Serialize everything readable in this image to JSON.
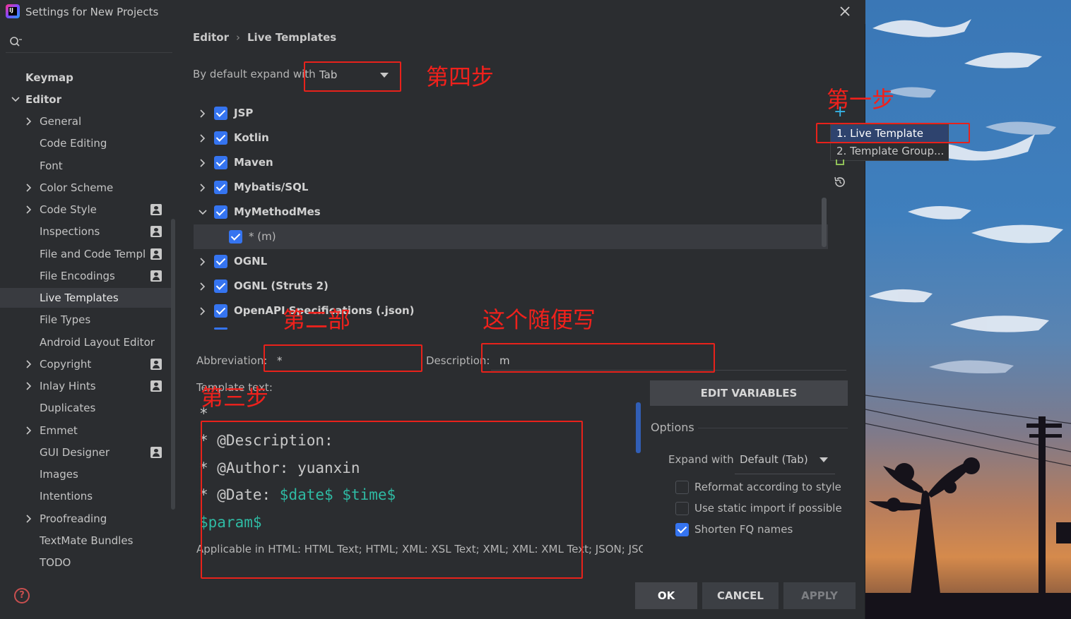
{
  "window": {
    "title": "Settings for New Projects",
    "app_icon_text": "IJ"
  },
  "sidebar": {
    "items": [
      {
        "label": "Keymap",
        "bold": true
      },
      {
        "label": "Editor",
        "bold": true
      },
      {
        "label": "General"
      },
      {
        "label": "Code Editing"
      },
      {
        "label": "Font"
      },
      {
        "label": "Color Scheme"
      },
      {
        "label": "Code Style"
      },
      {
        "label": "Inspections"
      },
      {
        "label": "File and Code Templ"
      },
      {
        "label": "File Encodings"
      },
      {
        "label": "Live Templates"
      },
      {
        "label": "File Types"
      },
      {
        "label": "Android Layout Editor"
      },
      {
        "label": "Copyright"
      },
      {
        "label": "Inlay Hints"
      },
      {
        "label": "Duplicates"
      },
      {
        "label": "Emmet"
      },
      {
        "label": "GUI Designer"
      },
      {
        "label": "Images"
      },
      {
        "label": "Intentions"
      },
      {
        "label": "Proofreading"
      },
      {
        "label": "TextMate Bundles"
      },
      {
        "label": "TODO"
      }
    ],
    "help": "?"
  },
  "breadcrumb": {
    "parent": "Editor",
    "sep": "›",
    "current": "Live Templates"
  },
  "expand": {
    "label": "By default expand with",
    "value": "Tab"
  },
  "tree": {
    "rows": [
      {
        "name": "JSP"
      },
      {
        "name": "Kotlin"
      },
      {
        "name": "Maven"
      },
      {
        "name": "Mybatis/SQL"
      },
      {
        "name": "MyMethodMes"
      },
      {
        "name": "* (m)"
      },
      {
        "name": "OGNL"
      },
      {
        "name": "OGNL (Struts 2)"
      },
      {
        "name": "OpenAPI Specifications (.json)"
      }
    ]
  },
  "form": {
    "abbreviation_label": "Abbreviation:",
    "abbreviation_value": "*",
    "description_label": "Description:",
    "description_value": "m",
    "template_text_label": "Template text:"
  },
  "template": {
    "line0": "*",
    "line1": "* @Description:",
    "line2": "* @Author: yuanxin",
    "line3_prefix": "* @Date: ",
    "line3_var1": "$date$",
    "line3_var2": "$time$",
    "line4_var": "$param$"
  },
  "applicable": "Applicable in HTML: HTML Text; HTML; XML: XSL Text; XML; XML: XML Text; JSON; JSC",
  "right_panel": {
    "edit_variables": "EDIT VARIABLES",
    "options": "Options",
    "expand_with_label": "Expand with",
    "expand_with_value": "Default (Tab)",
    "reformat": "Reformat according to style",
    "static_import": "Use static import if possible",
    "shorten_fq": "Shorten FQ names"
  },
  "popup": {
    "item1": "1. Live Template",
    "item2": "2. Template Group..."
  },
  "buttons": {
    "ok": "OK",
    "cancel": "CANCEL",
    "apply": "APPLY"
  },
  "annotations": {
    "step1": "第一步",
    "step2": "第二部",
    "step3": "第三步",
    "step4": "第四步",
    "anything": "这个随便写"
  },
  "colors": {
    "accent": "#3574f0",
    "annotation": "#e8221b",
    "variable": "#2fbaa3"
  },
  "icons": [
    "search-icon",
    "close-icon",
    "chevron-right-icon",
    "chevron-down-icon",
    "project-scope-icon",
    "add-icon",
    "revert-icon",
    "help-icon"
  ]
}
